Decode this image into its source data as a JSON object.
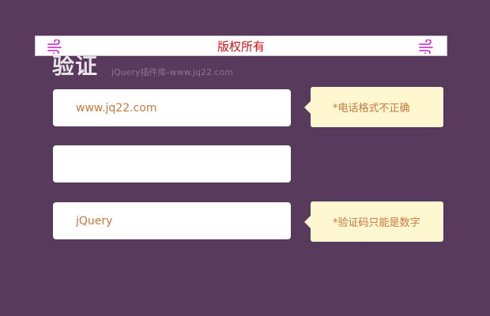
{
  "banner": {
    "text": "版权所有",
    "icon_left": "wind-icon",
    "icon_right": "wind-icon"
  },
  "header": {
    "title": "验证",
    "subtitle": "jQuery插件库-www.jq22.com"
  },
  "form": {
    "phone_value": "www.jq22.com",
    "middle_value": "",
    "code_value": "jQuery"
  },
  "tips": {
    "phone_error": "*电话格式不正确",
    "code_error": "*验证码只能是数字"
  },
  "colors": {
    "background": "#583b5c",
    "banner_text": "#d0101a",
    "wind_icon": "#d119c9",
    "field_text": "#c77a42",
    "tip_background": "#fff7cf"
  }
}
